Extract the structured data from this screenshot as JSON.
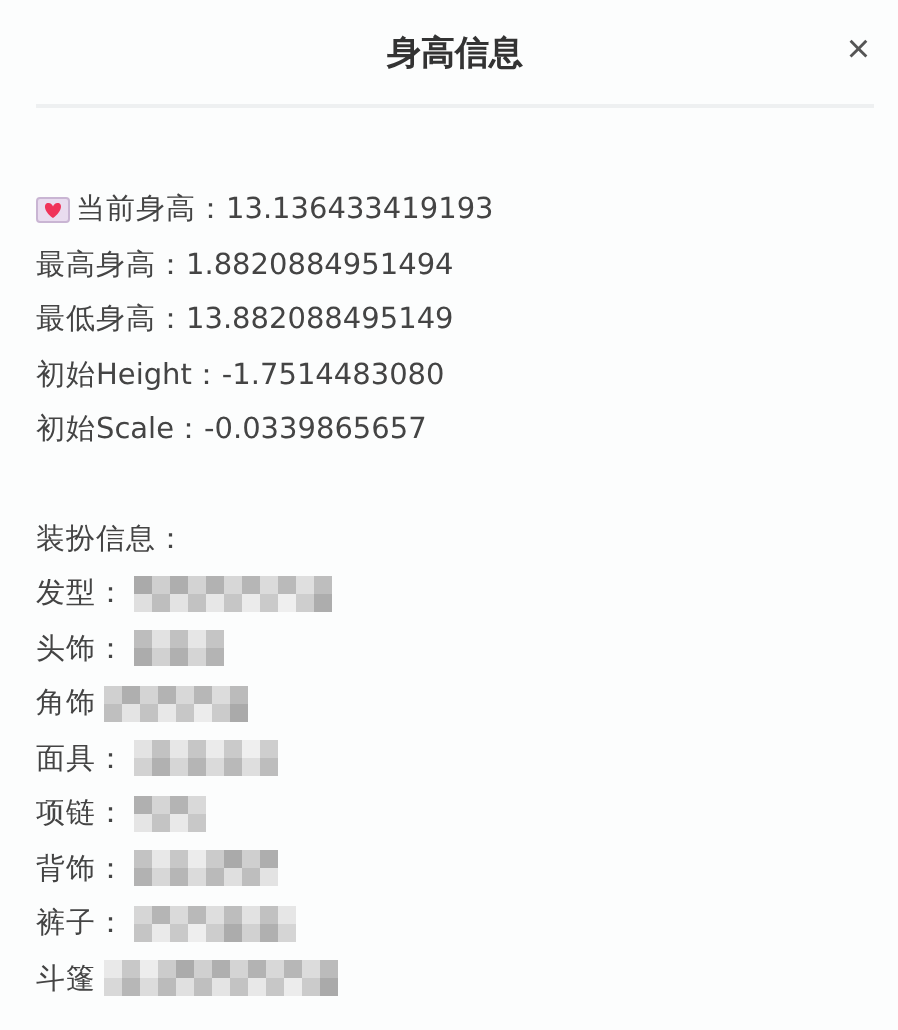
{
  "dialog": {
    "title": "身高信息",
    "close": "×"
  },
  "height_info": [
    {
      "text": "当前身高：13.136433419193",
      "icon": true
    },
    {
      "text": "最高身高：1.8820884951494",
      "icon": false
    },
    {
      "text": "最低身高：13.882088495149",
      "icon": false
    },
    {
      "text": "初始Height：-1.7514483080",
      "icon": false
    },
    {
      "text": "初始Scale：-0.0339865657",
      "icon": false
    }
  ],
  "outfit": {
    "heading": "装扮信息：",
    "items": [
      {
        "label": "发型："
      },
      {
        "label": "头饰："
      },
      {
        "label": "角饰"
      },
      {
        "label": "面具："
      },
      {
        "label": "项链："
      },
      {
        "label": "背饰："
      },
      {
        "label": "裤子："
      },
      {
        "label": "斗篷"
      }
    ]
  }
}
